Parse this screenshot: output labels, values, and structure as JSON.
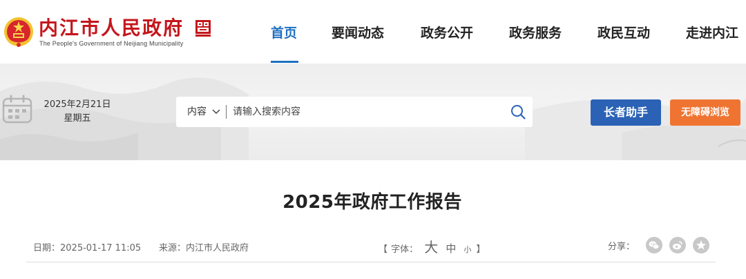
{
  "header": {
    "site_name": "内江市人民政府",
    "site_name_en": "The People's Government of Neijiang Municipality",
    "nav": [
      {
        "label": "首页",
        "active": true
      },
      {
        "label": "要闻动态",
        "active": false
      },
      {
        "label": "政务公开",
        "active": false
      },
      {
        "label": "政务服务",
        "active": false
      },
      {
        "label": "政民互动",
        "active": false
      },
      {
        "label": "走进内江",
        "active": false
      }
    ]
  },
  "toolbar": {
    "date": "2025年2月21日",
    "weekday": "星期五",
    "search_type": "内容",
    "search_placeholder": "请输入搜索内容",
    "elder_button": "长者助手",
    "accessibility_button": "无障碍浏览"
  },
  "article": {
    "title": "2025年政府工作报告",
    "date": "日期：2025-01-17 11:05",
    "source": "来源：内江市人民政府",
    "font_open": "【",
    "font_label": "字体：",
    "font_big": "大",
    "font_mid": "中",
    "font_small": "小",
    "font_close": "】",
    "share_label": "分享：",
    "share_icons": [
      "wechat-icon",
      "weibo-icon",
      "favorite-icon"
    ]
  },
  "colors": {
    "brand_red": "#c4161c",
    "nav_active": "#1e6fc2",
    "elder_button": "#2b62b5",
    "accessibility_button": "#ef7432"
  }
}
